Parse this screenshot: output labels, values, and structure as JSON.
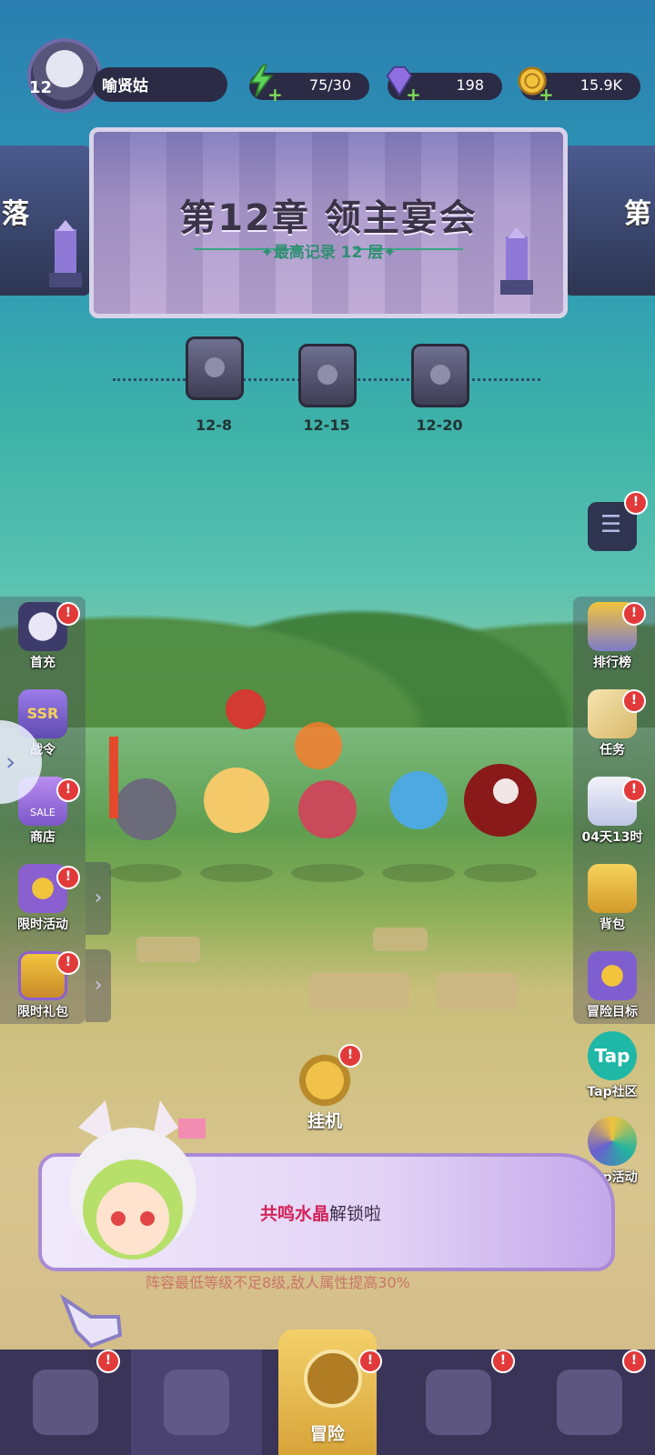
{
  "player": {
    "level": "12",
    "name": "喻贤姑"
  },
  "resources": {
    "energy": "75/30",
    "gems": "198",
    "gold": "15.9K"
  },
  "chapter": {
    "prev_partial": "落",
    "next_partial": "第",
    "title": "第12章  领主宴会",
    "record": "✦最高记录 12 层✦"
  },
  "chests": [
    {
      "label": "12-8"
    },
    {
      "label": "12-15"
    },
    {
      "label": "12-20"
    }
  ],
  "left_menu": [
    {
      "label": "首充"
    },
    {
      "label": "战令"
    },
    {
      "label": "商店"
    },
    {
      "label": "限时活动"
    },
    {
      "label": "限时礼包"
    }
  ],
  "right_menu": [
    {
      "label": "排行榜"
    },
    {
      "label": "任务"
    },
    {
      "label": "04天13时"
    },
    {
      "label": "背包"
    },
    {
      "label": "冒险目标"
    },
    {
      "label": "Tap社区"
    },
    {
      "label": "Tap活动"
    }
  ],
  "idle": {
    "label": "挂机"
  },
  "dialog": {
    "highlight": "共鸣水晶",
    "rest": "解锁啦"
  },
  "warning": "阵容最低等级不足8级,敌人属性提高30%",
  "nav": {
    "active_label": "冒险"
  },
  "badges": {
    "symbol": "!"
  },
  "icons": {
    "side_arrow": "›",
    "expand": "›",
    "ssr": "SSR",
    "tap": "Tap",
    "sale": "SALE"
  },
  "colors": {
    "badge": "#e23a3a",
    "nav_bg": "#3a3458",
    "dialog_highlight": "#d3235a"
  }
}
